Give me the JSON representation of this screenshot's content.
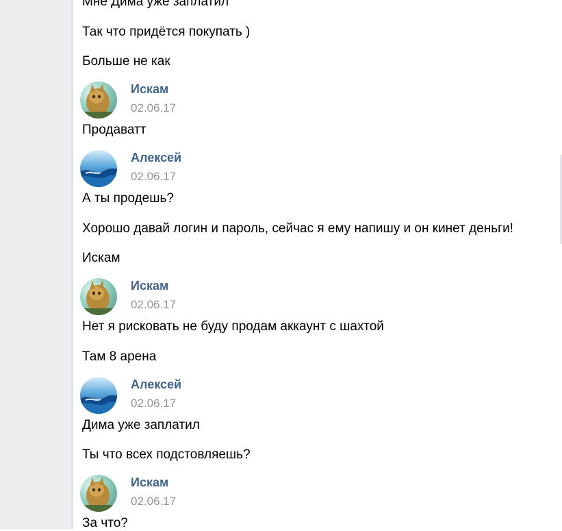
{
  "messages": [
    {
      "type": "text",
      "text": "Мне Дима уже заплатил"
    },
    {
      "type": "text",
      "text": "Так что придётся покупать )"
    },
    {
      "type": "text",
      "text": "Больше не как"
    },
    {
      "type": "header",
      "author": "Искам",
      "date": "02.06.17",
      "avatar": "cat-avatar"
    },
    {
      "type": "text",
      "text": "Продаватт"
    },
    {
      "type": "header",
      "author": "Алексей",
      "date": "02.06.17",
      "avatar": "wave-avatar"
    },
    {
      "type": "text",
      "text": "А ты продешь?"
    },
    {
      "type": "text",
      "text": "Хорошо давай логин и пароль, сейчас я ему напишу и он кинет деньги!"
    },
    {
      "type": "text",
      "text": "Искам"
    },
    {
      "type": "header",
      "author": "Искам",
      "date": "02.06.17",
      "avatar": "cat-avatar"
    },
    {
      "type": "text",
      "text": "Нет я рисковать не буду продам аккаунт с шахтой"
    },
    {
      "type": "text",
      "text": "Там 8 арена"
    },
    {
      "type": "header",
      "author": "Алексей",
      "date": "02.06.17",
      "avatar": "wave-avatar"
    },
    {
      "type": "text",
      "text": "Дима уже заплатил"
    },
    {
      "type": "text",
      "text": "Ты что всех подстовляешь?"
    },
    {
      "type": "header",
      "author": "Искам",
      "date": "02.06.17",
      "avatar": "cat-avatar"
    },
    {
      "type": "text",
      "text": "За что?"
    }
  ],
  "colors": {
    "author": "#42648b",
    "date": "#939393",
    "sidebar": "#edeef0"
  }
}
